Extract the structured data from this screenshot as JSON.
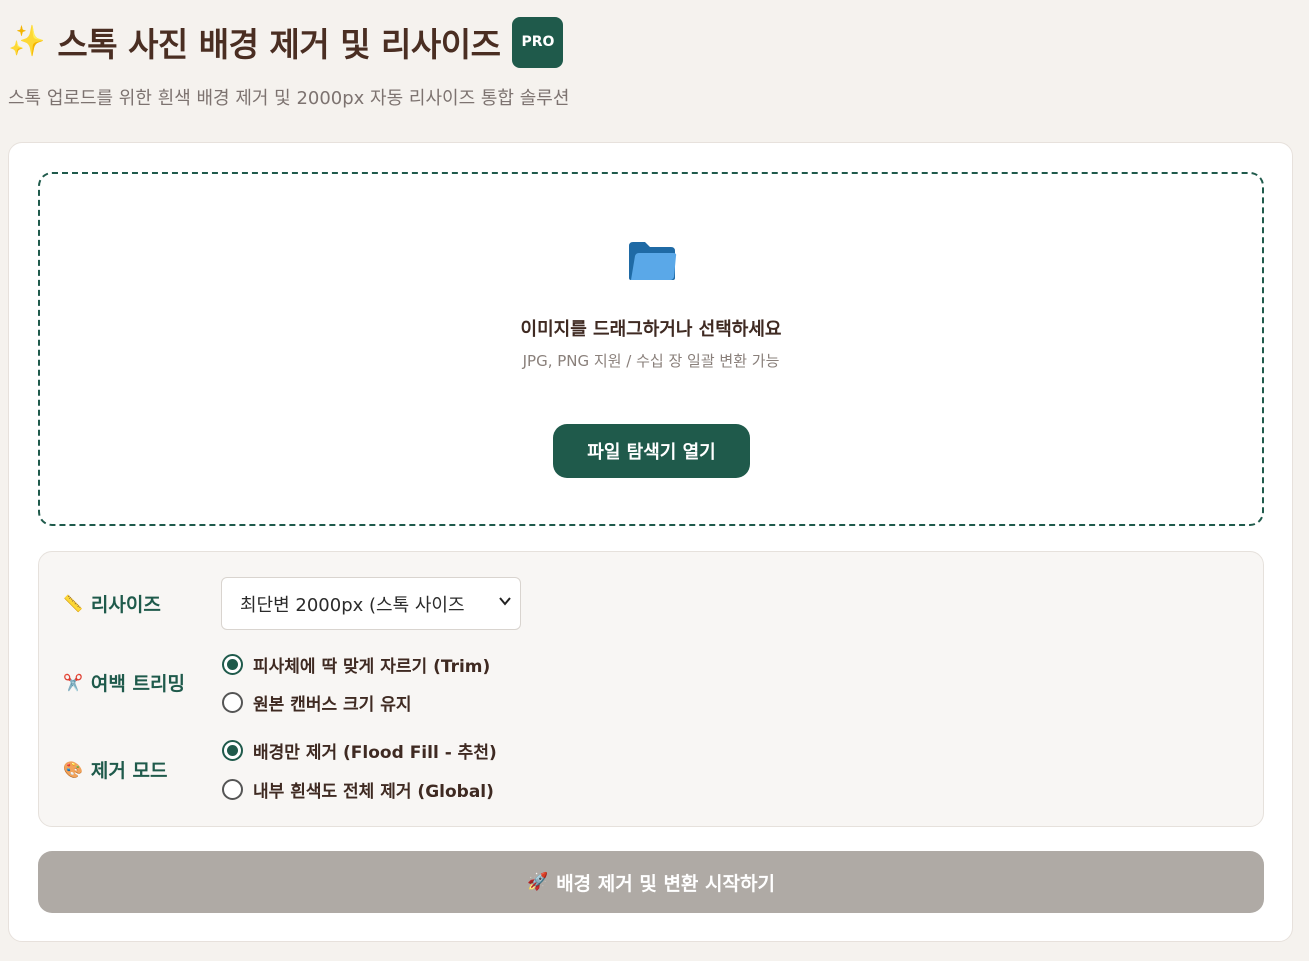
{
  "header": {
    "icon": "sparkles-icon",
    "title": "스톡 사진 배경 제거 및 리사이즈",
    "badge": "PRO",
    "subtitle": "스톡 업로드를 위한 흰색 배경 제거 및 2000px 자동 리사이즈 통합 솔루션"
  },
  "dropzone": {
    "icon": "folder-icon",
    "title": "이미지를 드래그하거나 선택하세요",
    "subtitle": "JPG, PNG 지원 / 수십 장 일괄 변환 가능",
    "button_label": "파일 탐색기 열기"
  },
  "options": {
    "resize": {
      "icon": "ruler-icon",
      "label": "리사이즈",
      "selected": "최단변 2000px (스톡 사이즈"
    },
    "trim": {
      "icon": "scissors-icon",
      "label": "여백 트리밍",
      "choices": [
        {
          "label": "피사체에 딱 맞게 자르기 (Trim)",
          "checked": true
        },
        {
          "label": "원본 캔버스 크기 유지",
          "checked": false
        }
      ]
    },
    "mode": {
      "icon": "palette-icon",
      "label": "제거 모드",
      "choices": [
        {
          "label": "배경만 제거 (Flood Fill - 추천)",
          "checked": true
        },
        {
          "label": "내부 흰색도 전체 제거 (Global)",
          "checked": false
        }
      ]
    }
  },
  "start_button": {
    "icon": "rocket-icon",
    "label": "배경 제거 및 변환 시작하기"
  },
  "colors": {
    "accent": "#1f5a4b",
    "disabled": "#afaaa5",
    "background": "#f5f2ee"
  }
}
